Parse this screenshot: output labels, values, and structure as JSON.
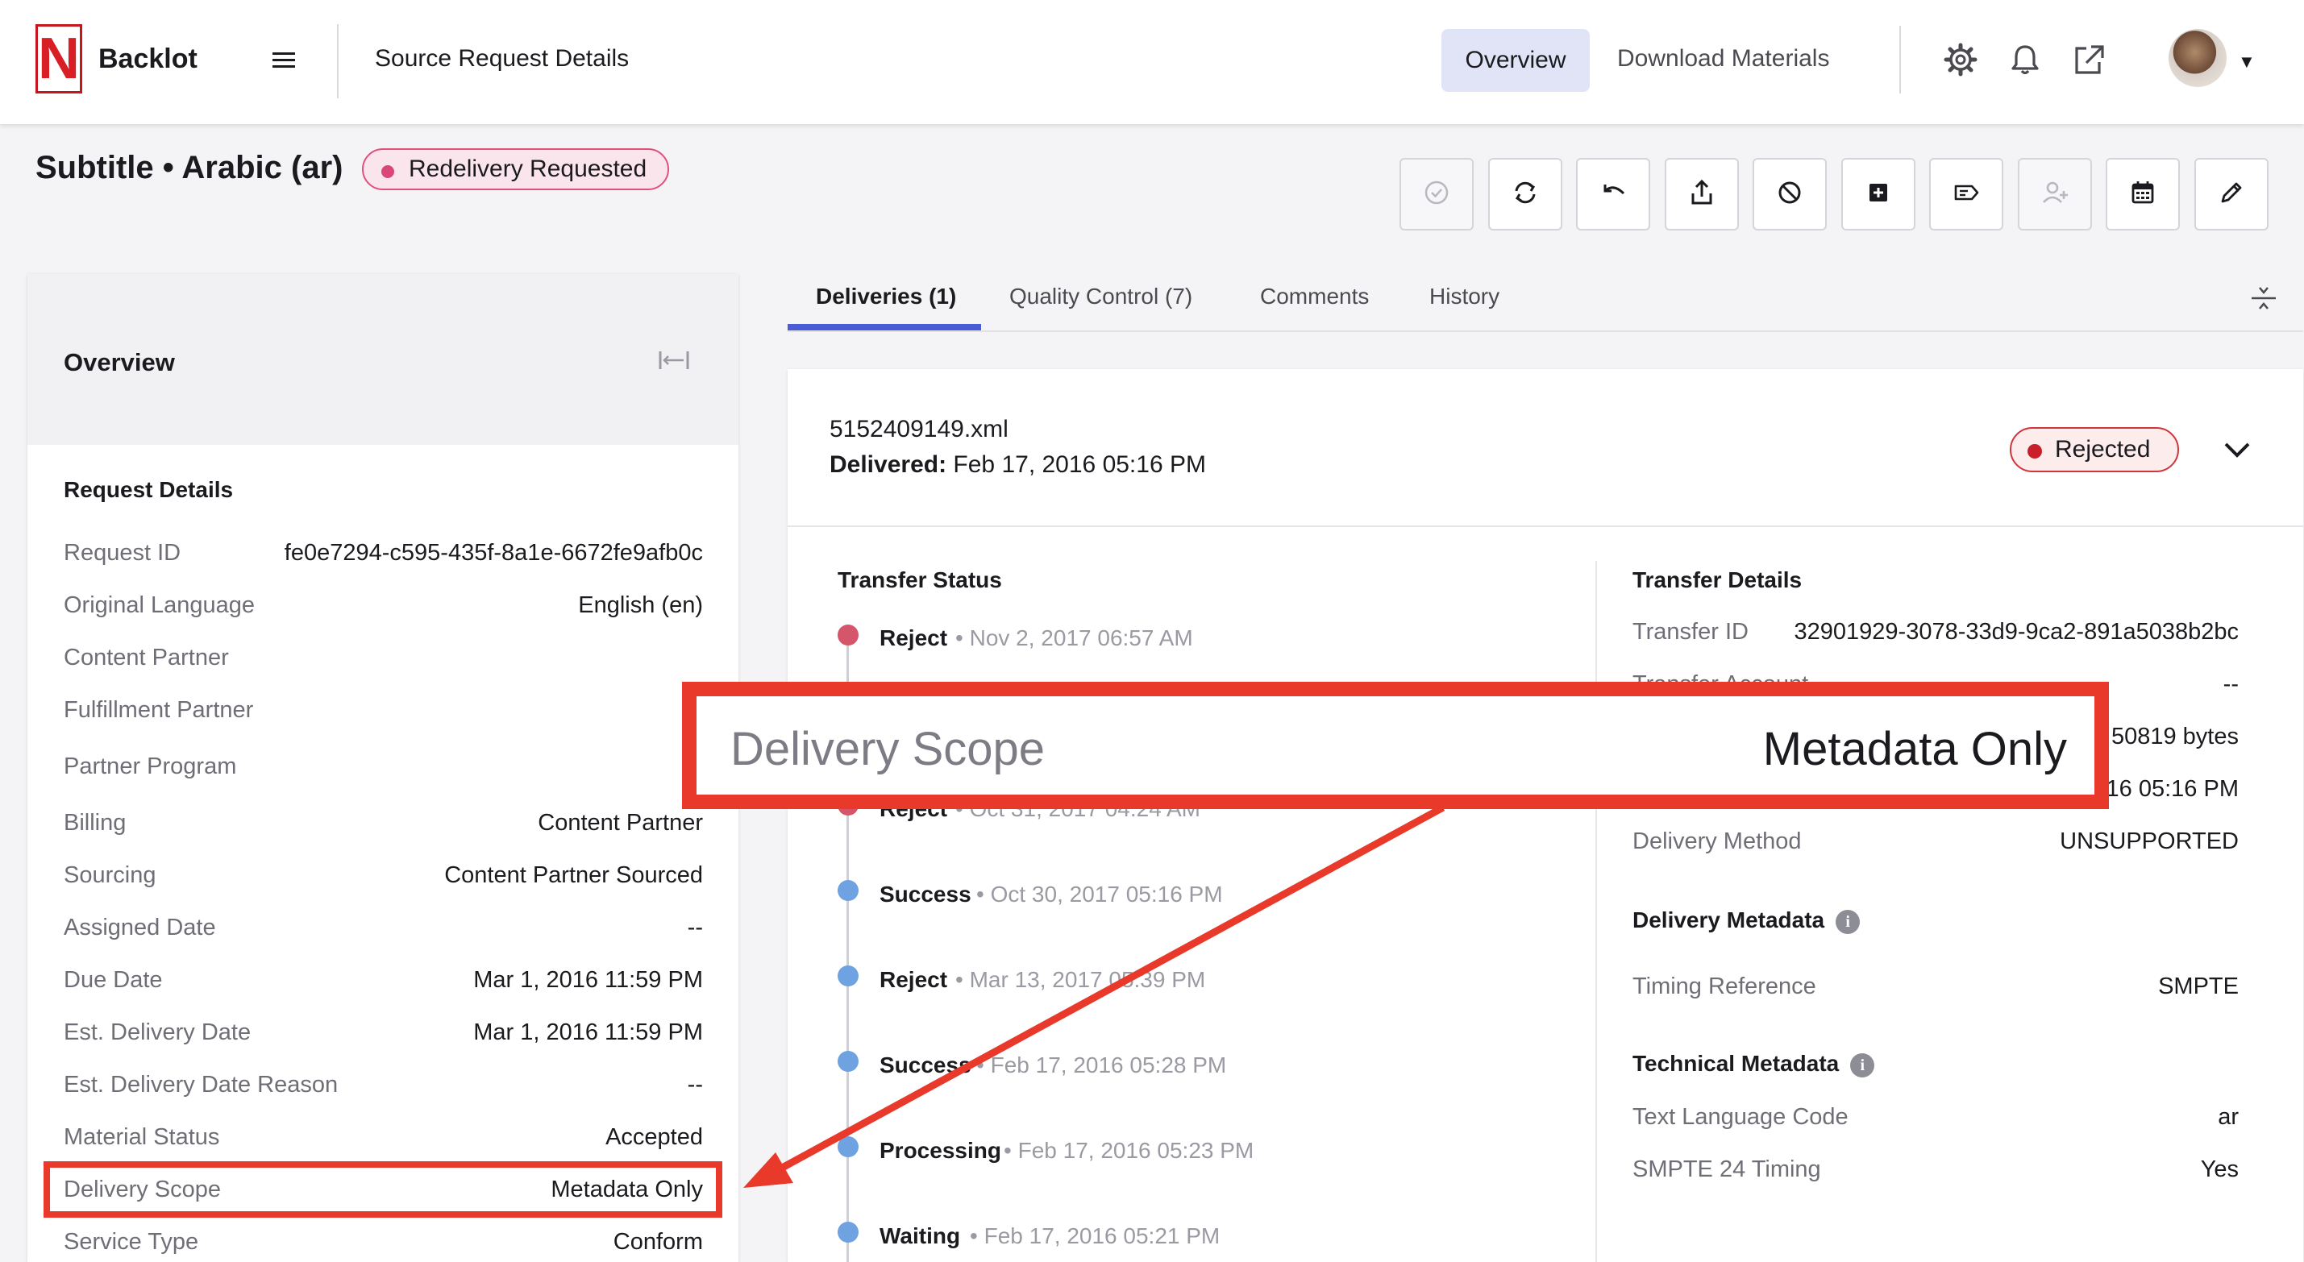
{
  "app": {
    "logo_letter": "N",
    "name": "Backlot",
    "page_heading": "Source Request Details"
  },
  "nav": {
    "overview": "Overview",
    "download_materials": "Download Materials"
  },
  "icons": {
    "menu": "hamburger-menu-icon",
    "settings": "gear-icon",
    "notifications": "bell-icon",
    "external": "external-link-icon",
    "account": "avatar",
    "collapse": "collapse-panel-icon",
    "expand_toggle": "chevron-down-icon",
    "compress": "compress-icon",
    "toolbar": [
      "check-circle-icon",
      "refresh-icon",
      "undo-icon",
      "upload-icon",
      "block-icon",
      "add-box-icon",
      "label-icon",
      "add-person-icon",
      "calendar-icon",
      "edit-pencil-icon"
    ]
  },
  "request": {
    "title": "Subtitle • Arabic (ar)",
    "status": "Redelivery Requested"
  },
  "overview_panel": {
    "title": "Overview",
    "section_title": "Request Details",
    "fields": [
      {
        "label": "Request ID",
        "value": "fe0e7294-c595-435f-8a1e-6672fe9afb0c"
      },
      {
        "label": "Original Language",
        "value": "English (en)"
      },
      {
        "label": "Content Partner",
        "value": ""
      },
      {
        "label": "Fulfillment Partner",
        "value": ""
      },
      {
        "label": "Partner Program",
        "value": ""
      },
      {
        "label": "Billing",
        "value": "Content Partner"
      },
      {
        "label": "Sourcing",
        "value": "Content Partner Sourced"
      },
      {
        "label": "Assigned Date",
        "value": "--"
      },
      {
        "label": "Due Date",
        "value": "Mar 1, 2016 11:59 PM"
      },
      {
        "label": "Est. Delivery Date",
        "value": "Mar 1, 2016 11:59 PM"
      },
      {
        "label": "Est. Delivery Date Reason",
        "value": "--"
      },
      {
        "label": "Material Status",
        "value": "Accepted"
      },
      {
        "label": "Delivery Scope",
        "value": "Metadata Only"
      },
      {
        "label": "Service Type",
        "value": "Conform"
      }
    ]
  },
  "tabs": [
    {
      "label": "Deliveries (1)"
    },
    {
      "label": "Quality Control (7)"
    },
    {
      "label": "Comments"
    },
    {
      "label": "History"
    }
  ],
  "delivery": {
    "file_name": "5152409149.xml",
    "delivered_label": "Delivered:",
    "delivered_value": "Feb 17, 2016 05:16 PM",
    "status": "Rejected"
  },
  "transfer_status": {
    "title": "Transfer Status",
    "events": [
      {
        "status": "Reject",
        "date": "Nov 2, 2017 06:57 AM"
      },
      {
        "status": "Reject",
        "date": "Oct 31, 2017 04:24 AM"
      },
      {
        "status": "Success",
        "date": "Oct 30, 2017 05:16 PM"
      },
      {
        "status": "Reject",
        "date": "Mar 13, 2017 05:39 PM"
      },
      {
        "status": "Success",
        "date": "Feb 17, 2016 05:28 PM"
      },
      {
        "status": "Processing",
        "date": "Feb 17, 2016 05:23 PM"
      },
      {
        "status": "Waiting",
        "date": "Feb 17, 2016 05:21 PM"
      }
    ]
  },
  "transfer_details": {
    "title": "Transfer Details",
    "rows": [
      {
        "label": "Transfer ID",
        "value": "32901929-3078-33d9-9ca2-891a5038b2bc"
      },
      {
        "label": "Transfer Account",
        "value": "--"
      },
      {
        "label": "",
        "value": "50819 bytes"
      },
      {
        "label": "",
        "value": "16 05:16 PM"
      },
      {
        "label": "Delivery Method",
        "value": "UNSUPPORTED"
      }
    ],
    "delivery_metadata_title": "Delivery Metadata",
    "delivery_metadata": [
      {
        "label": "Timing Reference",
        "value": "SMPTE"
      }
    ],
    "technical_metadata_title": "Technical Metadata",
    "technical_metadata": [
      {
        "label": "Text Language Code",
        "value": "ar"
      },
      {
        "label": "SMPTE 24 Timing",
        "value": "Yes"
      }
    ],
    "info_glyph": "i"
  },
  "callout": {
    "label": "Delivery Scope",
    "value": "Metadata Only"
  },
  "colors": {
    "accent": "#4a5bd6",
    "annotation": "#e8392a",
    "brand": "#d81f26"
  }
}
